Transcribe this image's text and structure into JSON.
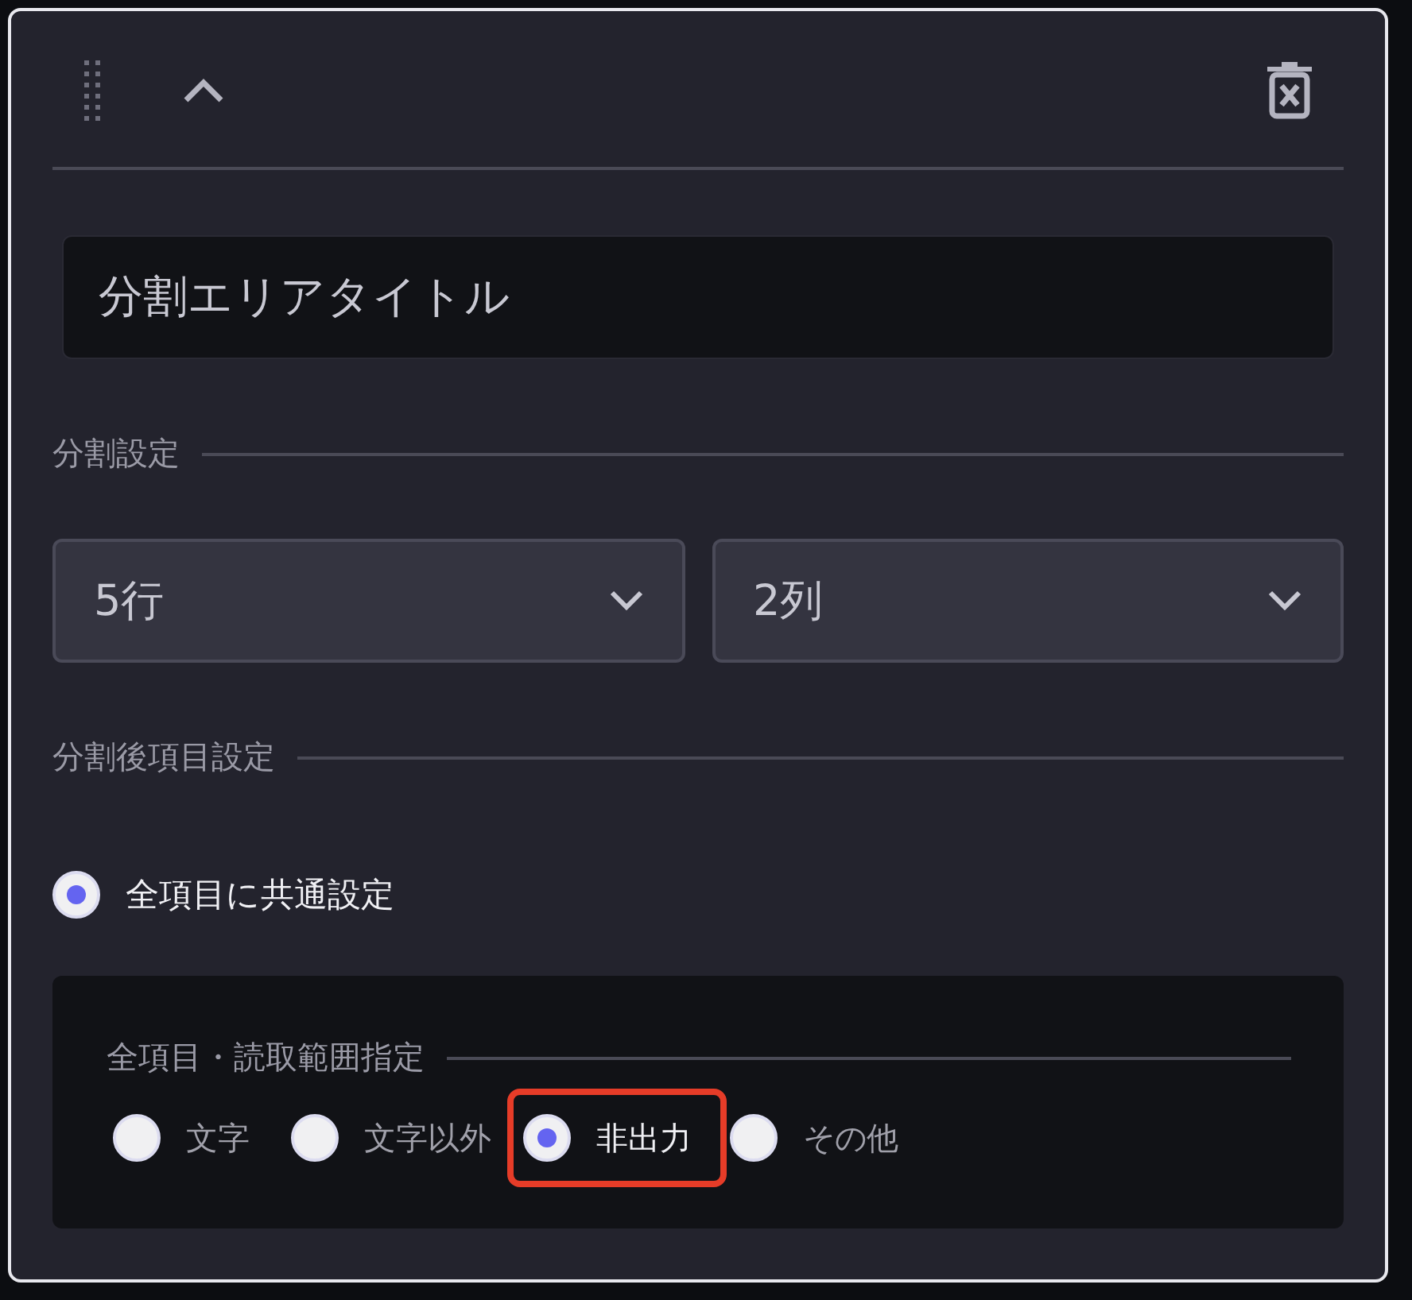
{
  "toolbar": {
    "collapsed": false
  },
  "title_field": {
    "value": "分割エリアタイトル"
  },
  "split_settings": {
    "label": "分割設定",
    "selects": [
      {
        "value": "5行"
      },
      {
        "value": "2列"
      }
    ]
  },
  "item_settings": {
    "label": "分割後項目設定",
    "mode": {
      "label": "全項目に共通設定",
      "selected": true
    },
    "panel": {
      "label": "全項目・読取範囲指定",
      "options": [
        {
          "label": "文字",
          "selected": false,
          "highlighted": false
        },
        {
          "label": "文字以外",
          "selected": false,
          "highlighted": false
        },
        {
          "label": "非出力",
          "selected": true,
          "highlighted": true
        },
        {
          "label": "その他",
          "selected": false,
          "highlighted": false
        }
      ]
    }
  }
}
